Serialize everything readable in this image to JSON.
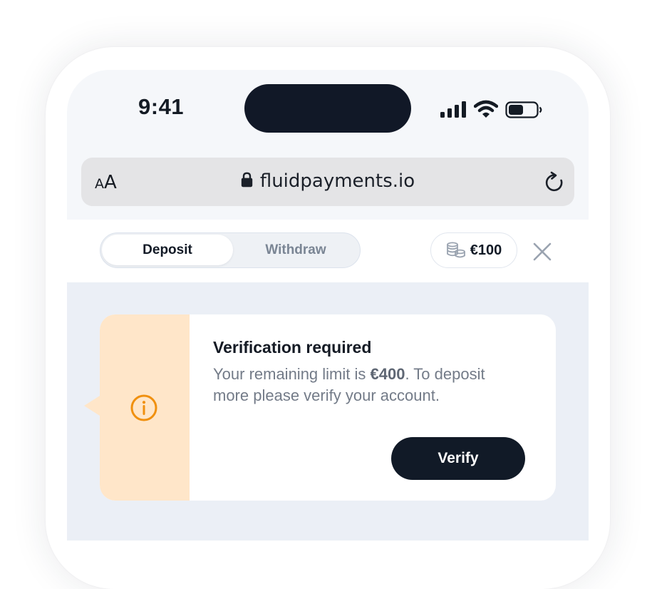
{
  "status_bar": {
    "time": "9:41"
  },
  "browser": {
    "text_size_small": "A",
    "text_size_large": "A",
    "url": "fluidpayments.io"
  },
  "tabs": {
    "deposit_label": "Deposit",
    "withdraw_label": "Withdraw"
  },
  "balance": {
    "amount": "€100"
  },
  "alert": {
    "title": "Verification required",
    "message_before": "Your remaining limit is ",
    "limit_amount": "€400",
    "message_after": ". To deposit more please verify your account.",
    "verify_label": "Verify"
  },
  "colors": {
    "accent_orange": "#f0900f",
    "alert_side_bg": "#ffe6c9",
    "primary_dark": "#111a27"
  }
}
